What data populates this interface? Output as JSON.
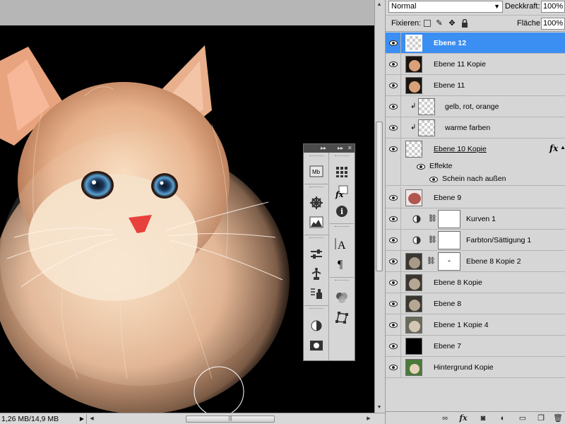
{
  "document": {
    "size_text": "1,26 MB/14,9 MB",
    "status_menu_icon": "triangle-right-icon"
  },
  "float_panel": {
    "header_arrows_left": "▸▸",
    "header_arrows_right": "▸▸",
    "close_glyph": "✕",
    "left_column": [
      "mini-bridge-icon",
      "navigator-icon",
      "histogram-icon",
      "adjustments-icon",
      "clone-source-icon",
      "actions-icon",
      "mask-icon",
      "frame-icon"
    ],
    "right_column": [
      "swatches-icon",
      "styles-icon",
      "info-icon",
      "character-icon",
      "paragraph-icon",
      "channels-icon",
      "paths-icon"
    ],
    "labels": {
      "mb": "Mb",
      "fx": "fx",
      "info": "i",
      "char": "A",
      "para": "¶"
    }
  },
  "layers_panel": {
    "blend_mode": "Normal",
    "opacity_label": "Deckkraft:",
    "opacity_value": "100%",
    "lock_label": "Fixieren:",
    "fill_label": "Fläche:",
    "fill_value": "100%",
    "fx_label": "fx",
    "layers": [
      {
        "name": "Ebene 12",
        "selected": true,
        "thumb": "checker"
      },
      {
        "name": "Ebene 11 Kopie",
        "thumb": "cat"
      },
      {
        "name": "Ebene 11",
        "thumb": "cat"
      },
      {
        "name": "gelb, rot, orange",
        "clipped": true,
        "thumb": "checker"
      },
      {
        "name": "warme farben",
        "clipped": true,
        "thumb": "checker"
      },
      {
        "name": "Ebene 10 Kopie",
        "thumb": "checker",
        "has_fx": true
      },
      {
        "name": "Ebene 9",
        "thumb": "reddish"
      },
      {
        "name": "Kurven 1",
        "adjustment": "curves"
      },
      {
        "name": "Farbton/Sättigung 1",
        "adjustment": "hue-sat"
      },
      {
        "name": "Ebene 8 Kopie 2",
        "thumb": "gray-cat",
        "has_mask": true
      },
      {
        "name": "Ebene 8 Kopie",
        "thumb": "gray-cat"
      },
      {
        "name": "Ebene 8",
        "thumb": "gray-cat"
      },
      {
        "name": "Ebene 1 Kopie 4",
        "thumb": "gray-cat"
      },
      {
        "name": "Ebene 7",
        "thumb": "black"
      },
      {
        "name": "Hintergrund Kopie",
        "thumb": "green-cat"
      }
    ],
    "effects_label": "Effekte",
    "effect_item": "Schein nach außen",
    "footer_icons": [
      "link-icon",
      "fx-icon",
      "mask-add-icon",
      "adjustment-layer-icon",
      "group-icon",
      "new-layer-icon",
      "trash-icon"
    ],
    "footer_labels": {
      "fx": "fx"
    }
  },
  "colors": {
    "selection": "#3b8ef2",
    "panel_bg": "#d6d6d6",
    "canvas_bg": "#000000"
  }
}
